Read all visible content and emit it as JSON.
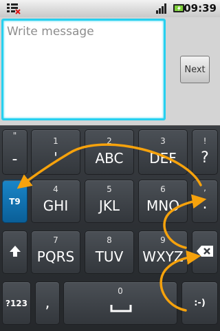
{
  "status_bar": {
    "time": "09:39",
    "icons": [
      "notification-icon",
      "signal-icon",
      "battery-charging-icon"
    ]
  },
  "compose": {
    "placeholder": "Write message",
    "value": "",
    "next_label": "Next"
  },
  "keyboard": {
    "colors": {
      "accent": "#0a6fb3",
      "arrow": "#f6a20c"
    },
    "row1": [
      {
        "top": "\"",
        "main": "-"
      },
      {
        "top": "1",
        "main": "'"
      },
      {
        "top": "2",
        "main": "ABC"
      },
      {
        "top": "3",
        "main": "DEF"
      },
      {
        "top": "!",
        "main": "?"
      }
    ],
    "row2": [
      {
        "main": "T9"
      },
      {
        "top": "4",
        "main": "GHI"
      },
      {
        "top": "5",
        "main": "JKL"
      },
      {
        "top": "6",
        "main": "MNO"
      },
      {
        "top": ",",
        "main": "."
      }
    ],
    "row3": [
      {
        "icon": "shift-arrow-icon"
      },
      {
        "top": "7",
        "main": "PQRS"
      },
      {
        "top": "8",
        "main": "TUV"
      },
      {
        "top": "9",
        "main": "WXYZ"
      },
      {
        "icon": "backspace-icon"
      }
    ],
    "row4": [
      {
        "main": "?123"
      },
      {
        "main": ","
      },
      {
        "top": "0",
        "icon": "space-bar-icon"
      },
      {
        "main": ":-)"
      }
    ]
  }
}
